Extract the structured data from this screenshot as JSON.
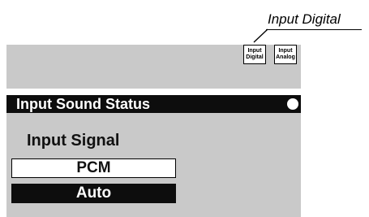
{
  "callout": {
    "text": "Input Digital"
  },
  "mode_buttons": {
    "digital": {
      "line1": "Input",
      "line2": "Digital"
    },
    "analog": {
      "line1": "Input",
      "line2": "Analog"
    }
  },
  "status_panel": {
    "title": "Input Sound Status",
    "signal_label": "Input Signal",
    "options": [
      "PCM",
      "Auto"
    ],
    "selected_option": "Auto"
  },
  "colors": {
    "panel_background": "#c9c9c9",
    "header_background": "#0d0d0d",
    "header_text": "#ffffff",
    "selected_background": "#0d0d0d"
  },
  "icons": {
    "status_indicator": "white-dot-icon"
  }
}
